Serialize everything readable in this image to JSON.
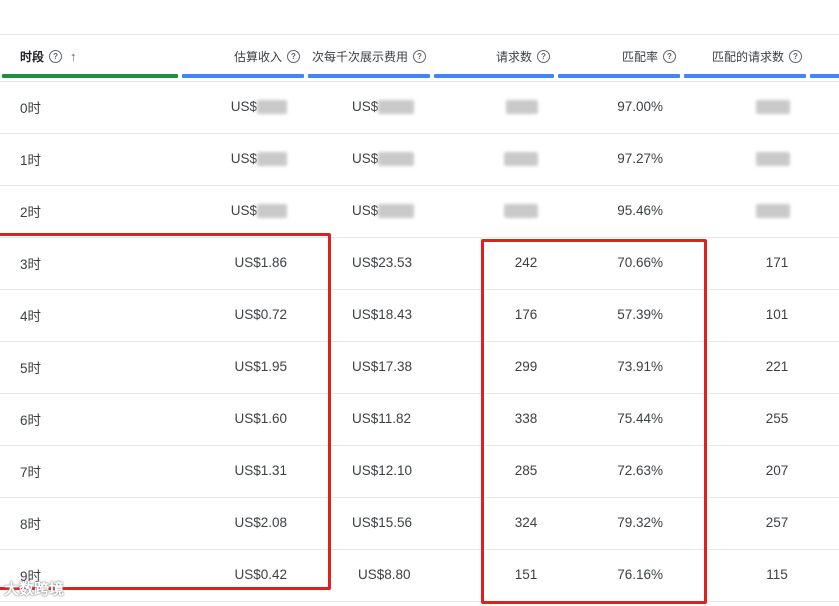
{
  "headers": {
    "period": "时段",
    "revenue": "估算收入",
    "rpm": "次每千次展示费用",
    "requests": "请求数",
    "match_rate": "匹配率",
    "matched_requests": "匹配的请求数"
  },
  "icons": {
    "help": "help-circle-icon",
    "sort": "arrow-up-icon"
  },
  "colors": {
    "period_bar": "#1e8e3e",
    "metric_bar": "#4285f4",
    "highlight_box": "#e01f1f"
  },
  "rows": [
    {
      "period": "0时",
      "revenue": "US$",
      "rpm": "US$",
      "requests": "",
      "match_rate": "97.00%",
      "matched": ""
    },
    {
      "period": "1时",
      "revenue": "US$",
      "rpm": "US$",
      "requests": "",
      "match_rate": "97.27%",
      "matched": ""
    },
    {
      "period": "2时",
      "revenue": "US$",
      "rpm": "US$",
      "requests": "",
      "match_rate": "95.46%",
      "matched": ""
    },
    {
      "period": "3时",
      "revenue": "US$1.86",
      "rpm": "US$23.53",
      "requests": "242",
      "match_rate": "70.66%",
      "matched": "171"
    },
    {
      "period": "4时",
      "revenue": "US$0.72",
      "rpm": "US$18.43",
      "requests": "176",
      "match_rate": "57.39%",
      "matched": "101"
    },
    {
      "period": "5时",
      "revenue": "US$1.95",
      "rpm": "US$17.38",
      "requests": "299",
      "match_rate": "73.91%",
      "matched": "221"
    },
    {
      "period": "6时",
      "revenue": "US$1.60",
      "rpm": "US$11.82",
      "requests": "338",
      "match_rate": "75.44%",
      "matched": "255"
    },
    {
      "period": "7时",
      "revenue": "US$1.31",
      "rpm": "US$12.10",
      "requests": "285",
      "match_rate": "72.63%",
      "matched": "207"
    },
    {
      "period": "8时",
      "revenue": "US$2.08",
      "rpm": "US$15.56",
      "requests": "324",
      "match_rate": "79.32%",
      "matched": "257"
    },
    {
      "period": "9时",
      "revenue": "US$0.42",
      "rpm": "US$8.80",
      "requests": "151",
      "match_rate": "76.16%",
      "matched": "115"
    }
  ],
  "watermark": "大数跨境"
}
